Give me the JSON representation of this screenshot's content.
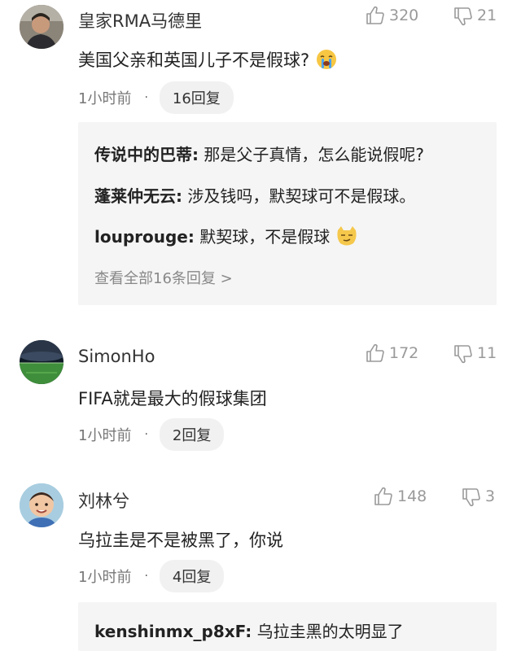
{
  "comments": [
    {
      "username": "皇家RMA马德里",
      "likes": "320",
      "dislikes": "21",
      "text": "美国父亲和英国儿子不是假球?",
      "time": "1小时前",
      "dot": "·",
      "replies_label": "16回复",
      "emoji_icon": "crying-face-icon",
      "replies": [
        {
          "name": "传说中的巴蒂:",
          "text": " 那是父子真情，怎么能说假呢?"
        },
        {
          "name": "蓬莱仲无云:",
          "text": " 涉及钱吗，默契球可不是假球。"
        },
        {
          "name": "louprouge:",
          "text": " 默契球，不是假球",
          "emoji_icon": "smirk-cat-icon"
        }
      ],
      "view_all": "查看全部16条回复 >"
    },
    {
      "username": "SimonHo",
      "likes": "172",
      "dislikes": "11",
      "text": "FIFA就是最大的假球集团",
      "time": "1小时前",
      "dot": "·",
      "replies_label": "2回复"
    },
    {
      "username": "刘林兮",
      "likes": "148",
      "dislikes": "3",
      "text": "乌拉圭是不是被黑了，你说",
      "time": "1小时前",
      "dot": "·",
      "replies_label": "4回复",
      "replies": [
        {
          "name": "kenshinmx_p8xF:",
          "text": " 乌拉圭黑的太明显了"
        }
      ]
    }
  ],
  "icons": {
    "like": "thumbs-up-icon",
    "dislike": "thumbs-down-icon"
  },
  "colors": {
    "stat_gray": "#9a9a9a",
    "reply_bg": "#f5f5f5",
    "pill_bg": "#f1f1f1"
  }
}
